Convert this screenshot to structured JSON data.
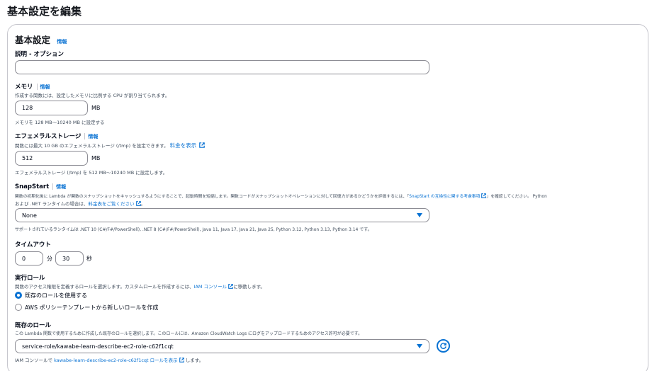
{
  "page_title": "基本設定を編集",
  "section": {
    "title": "基本設定",
    "info": "情報"
  },
  "description_field": {
    "label": "説明 - オプション",
    "value": "",
    "placeholder": ""
  },
  "memory": {
    "label": "メモリ",
    "info": "情報",
    "desc": "作成する関数には、設定したメモリに比例する CPU が割り当てられます。",
    "value": "128",
    "unit": "MB",
    "hint": "メモリを 128 MB～10240 MB に設定する"
  },
  "ephemeral": {
    "label": "エフェメラルストレージ",
    "info": "情報",
    "desc": "関数には最大 10 GB のエフェメラルストレージ (/tmp) を設定できます。",
    "pricing_link": "料金を表示",
    "value": "512",
    "unit": "MB",
    "hint": "エフェメラルストレージ (/tmp) を 512 MB～10240 MB に設定します。"
  },
  "snapstart": {
    "label": "SnapStart",
    "info": "情報",
    "desc_1": "関数の初期化後に Lambda が関数のスナップショットをキャッシュするようにすることで、起動時間を短縮します。関数コードがスナップショットオペレーションに対して回復力があるかどうかを評価するには、「",
    "compat_link": "SnapStart の互換性に関する考慮事項",
    "desc_2": "」を確認してください。 Python",
    "desc_3": "および .NET ランタイムの場合は、",
    "pricing_link": "料金表をご覧ください",
    "desc_4": "。",
    "selected": "None",
    "supported": "サポートされているランタイムは .NET 10 (C#/F#/PowerShell), .NET 8 (C#/F#/PowerShell), Java 11, Java 17, Java 21, Java 25, Python 3.12, Python 3.13, Python 3.14 です。"
  },
  "timeout": {
    "label": "タイムアウト",
    "minutes": "0",
    "min_unit": "分",
    "seconds": "30",
    "sec_unit": "秒"
  },
  "execution_role": {
    "label": "実行ロール",
    "desc_1": "関数のアクセス権限を定義するロールを選択します。カスタムロールを作成するには、",
    "iam_link": "IAM コンソール",
    "desc_2": "に移動します。",
    "options": [
      "既存のロールを使用する",
      "AWS ポリシーテンプレートから新しいロールを作成"
    ],
    "selected_index": 0
  },
  "existing_role": {
    "label": "既存のロール",
    "desc": "この Lambda 関数で使用するために作成した既存のロールを選択します。このロールには、Amazon CloudWatch Logs にログをアップロードするためのアクセス許可が必要です。",
    "selected": "service-role/kawabe-learn-describe-ec2-role-c62f1cqt",
    "footer_1": "IAM コンソールで ",
    "footer_link": "kawabe-learn-describe-ec2-role-c62f1cqt ロールを表示",
    "footer_2": " します。"
  },
  "colors": {
    "accent": "#0972d3",
    "border": "#8c8c94",
    "text": "#000716",
    "muted": "#414d5c"
  }
}
